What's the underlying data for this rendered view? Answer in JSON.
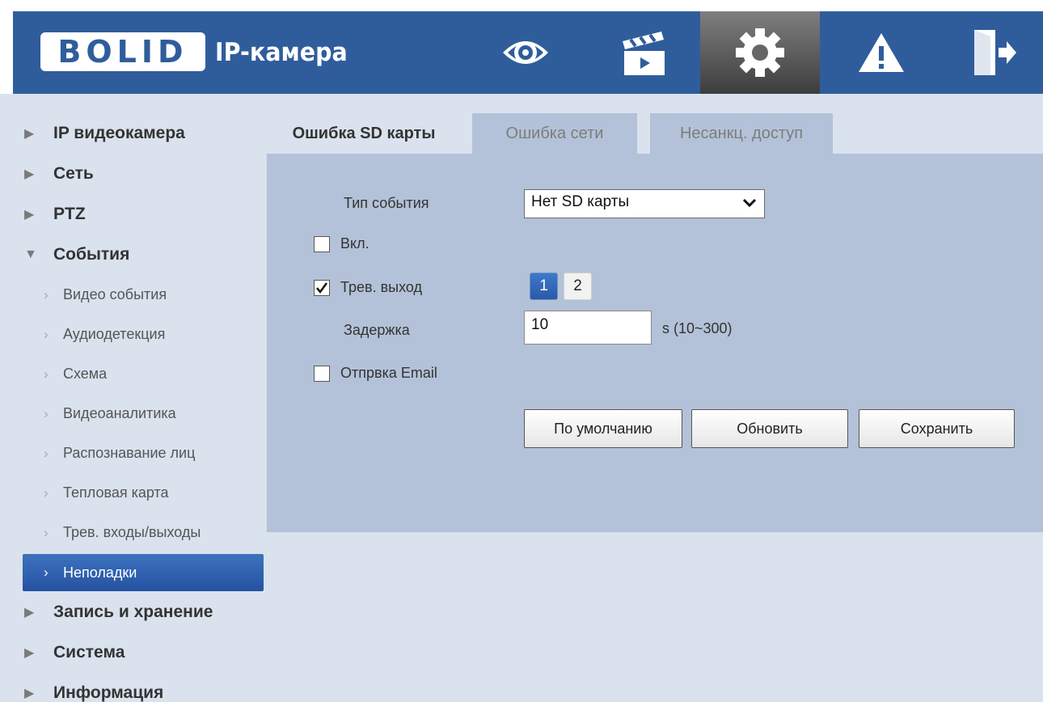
{
  "header": {
    "logo_text": "BOLID",
    "app_title": "IP-камера",
    "nav": [
      {
        "name": "live-view",
        "icon": "eye-icon"
      },
      {
        "name": "playback",
        "icon": "clapperboard-icon"
      },
      {
        "name": "setup",
        "icon": "gear-icon",
        "active": true
      },
      {
        "name": "alarm",
        "icon": "warning-icon"
      },
      {
        "name": "logout",
        "icon": "exit-icon"
      }
    ]
  },
  "sidebar": {
    "items": [
      {
        "label": "IP видеокамера",
        "expanded": false
      },
      {
        "label": "Сеть",
        "expanded": false
      },
      {
        "label": "PTZ",
        "expanded": false
      },
      {
        "label": "События",
        "expanded": true
      }
    ],
    "sub_items": [
      {
        "label": "Видео события"
      },
      {
        "label": "Аудиодетекция"
      },
      {
        "label": "Схема"
      },
      {
        "label": "Видеоаналитика"
      },
      {
        "label": "Распознавание лиц"
      },
      {
        "label": "Тепловая карта"
      },
      {
        "label": "Трев. входы/выходы"
      },
      {
        "label": "Неполадки",
        "active": true
      }
    ],
    "items_after": [
      {
        "label": "Запись и хранение"
      },
      {
        "label": "Система"
      },
      {
        "label": "Информация"
      }
    ]
  },
  "tabs": [
    {
      "label": "Ошибка SD карты",
      "active": true
    },
    {
      "label": "Ошибка сети"
    },
    {
      "label": "Несанкц. доступ"
    }
  ],
  "form": {
    "event_type_label": "Тип события",
    "event_type_value": "Нет SD карты",
    "enable_label": "Вкл.",
    "enable_checked": false,
    "alarm_out_label": "Трев. выход",
    "alarm_out_checked": true,
    "channels": [
      "1",
      "2"
    ],
    "selected_channel": "1",
    "delay_label": "Задержка",
    "delay_value": "10",
    "delay_range": "s (10~300)",
    "email_label": "Отпрвка Email",
    "email_checked": false
  },
  "buttons": {
    "default": "По умолчанию",
    "refresh": "Обновить",
    "save": "Сохранить"
  },
  "colors": {
    "header_blue": "#2f5d9c",
    "panel_blue": "#b3c2d8",
    "background": "#d9e2ed",
    "active_item": "#2e5fae"
  }
}
